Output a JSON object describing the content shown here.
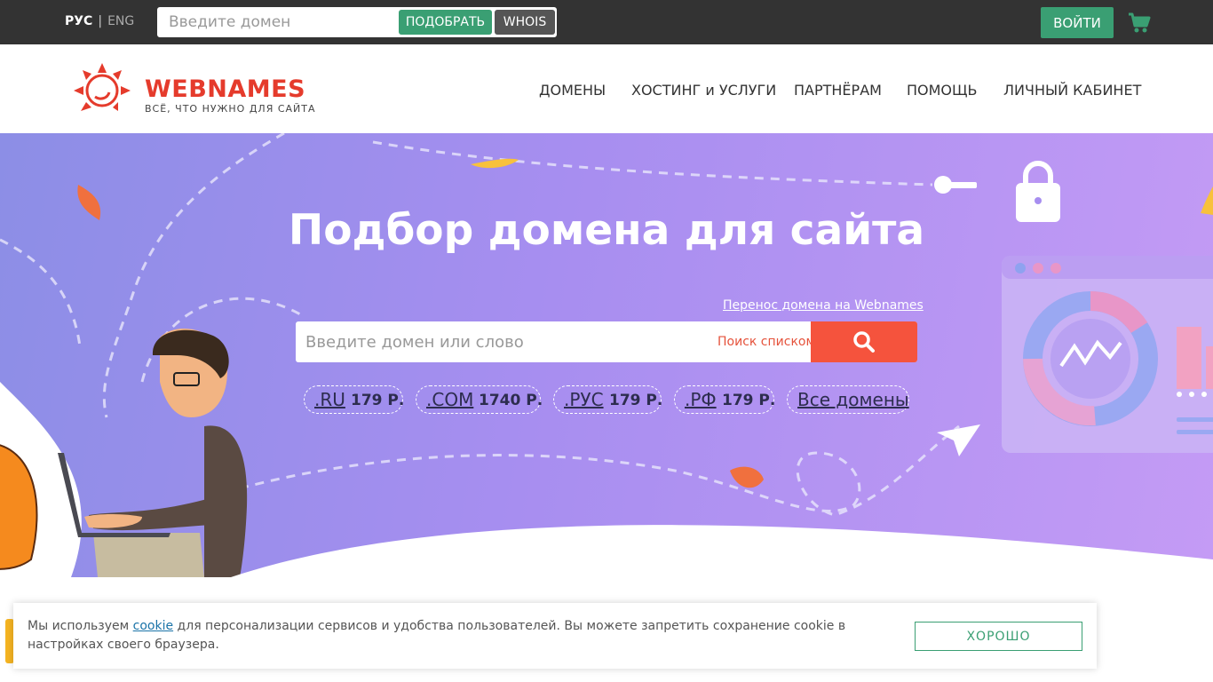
{
  "topbar": {
    "lang_ru": "РУС",
    "lang_sep": "|",
    "lang_en": "ENG",
    "search_placeholder": "Введите домен",
    "pick_label": "ПОДОБРАТЬ",
    "whois_label": "WHOIS",
    "login_label": "ВОЙТИ",
    "cart_icon": "cart-icon"
  },
  "header": {
    "logo_name": "WEBNAMES",
    "logo_tagline": "ВСЁ, ЧТО НУЖНО ДЛЯ САЙТА",
    "nav": [
      "ДОМЕНЫ",
      "ХОСТИНГ и УСЛУГИ",
      "ПАРТНЁРАМ",
      "ПОМОЩЬ",
      "ЛИЧНЫЙ КАБИНЕТ"
    ]
  },
  "hero": {
    "title": "Подбор домена для сайта",
    "transfer_link": "Перенос домена на Webnames",
    "search_placeholder": "Введите домен или слово",
    "list_search": "Поиск списком",
    "search_icon": "search-icon",
    "tlds": [
      {
        "tld": ".RU",
        "price": "179 Р."
      },
      {
        "tld": ".COM",
        "price": "1740 Р."
      },
      {
        "tld": ".РУС",
        "price": "179 Р."
      },
      {
        "tld": ".РФ",
        "price": "179 Р."
      }
    ],
    "all_domains": "Все домены"
  },
  "cookie": {
    "text_before": "Мы используем ",
    "link": "cookie",
    "text_after": " для персонализации сервисов и удобства пользователей. Вы можете запретить сохранение cookie в настройках своего браузера.",
    "ok_label": "ХОРОШО"
  },
  "colors": {
    "topbar_bg": "#333333",
    "green": "#3a9f73",
    "brand_red": "#e53b2c",
    "search_btn": "#f5533d",
    "hero_start": "#8c8ee6",
    "hero_end": "#c49bf5"
  }
}
